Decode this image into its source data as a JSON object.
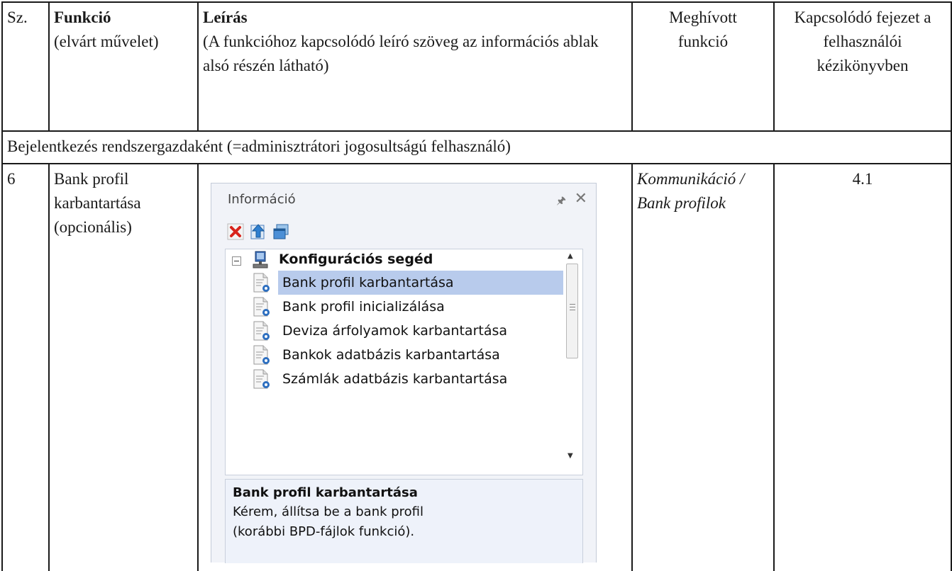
{
  "header": {
    "sz": "Sz.",
    "funkcio_title": "Funkció",
    "funkcio_sub": "(elvárt művelet)",
    "leiras_title": "Leírás",
    "leiras_sub": "(A funkcióhoz kapcsolódó leíró szöveg az információs ablak alsó részén látható)",
    "meghivott": "Meghívott funkció",
    "kapcsolodo": "Kapcsolódó fejezet a felhasználói kézikönyvben"
  },
  "section": {
    "label": "Bejelentkezés rendszergazdaként  (=adminisztrátori jogosultságú felhasználó)"
  },
  "row": {
    "number": "6",
    "function": "Bank profil karbantartása (opcionális)",
    "called": "Kommunikáció / Bank profilok",
    "chapter": "4.1"
  },
  "panel": {
    "title": "Információ",
    "pin_icon": "pin-icon",
    "close_icon": "close-icon",
    "toolbar": [
      "delete-icon",
      "up-icon",
      "window-icon"
    ],
    "tree": {
      "root": "Konfigurációs segéd",
      "items": [
        {
          "label": "Bank profil karbantartása",
          "selected": true
        },
        {
          "label": "Bank profil inicializálása",
          "selected": false
        },
        {
          "label": "Deviza árfolyamok karbantartása",
          "selected": false
        },
        {
          "label": "Bankok adatbázis karbantartása",
          "selected": false
        },
        {
          "label": "Számlák adatbázis karbantartása",
          "selected": false
        }
      ]
    },
    "description": {
      "title": "Bank profil karbantartása",
      "text": "Kérem, állítsa be a bank profil (korábbi BPD-fájlok funkció)."
    }
  },
  "colors": {
    "selection": "#b8cbec",
    "panel_bg": "#f1f3f8",
    "border": "#1a1a1a"
  }
}
